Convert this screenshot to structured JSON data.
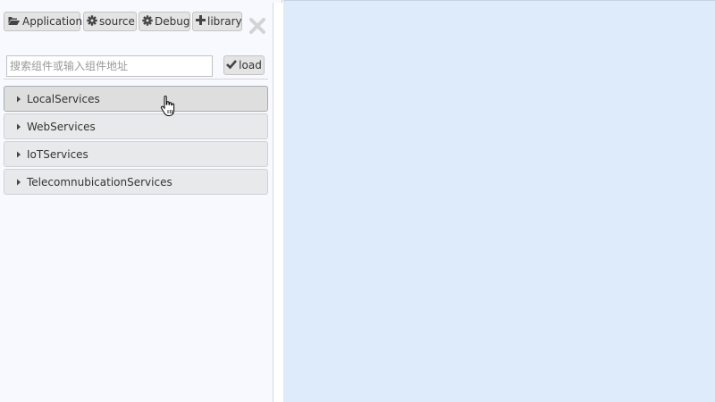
{
  "toolbar": {
    "buttons": [
      {
        "label": "Application",
        "icon": "folder-open-icon"
      },
      {
        "label": "source",
        "icon": "gear-icon"
      },
      {
        "label": "Debug",
        "icon": "gear-icon"
      },
      {
        "label": "library",
        "icon": "plus-icon"
      }
    ],
    "close_icon": "close-icon"
  },
  "search": {
    "placeholder": "搜索组件或输入组件地址",
    "value": ""
  },
  "load_button": {
    "label": "load",
    "icon": "check-icon"
  },
  "tree": {
    "categories": [
      {
        "label": "LocalServices",
        "active": true
      },
      {
        "label": "WebServices",
        "active": false
      },
      {
        "label": "IoTServices",
        "active": false
      },
      {
        "label": "TelecomnubicationServices",
        "active": false
      }
    ]
  },
  "colors": {
    "panel_bg": "#f8f9ff",
    "canvas_bg": "#deebfa",
    "button_bg": "#e4e4e4",
    "category_bg": "#e8e9ea"
  },
  "cursor": "hand-pointer-icon"
}
